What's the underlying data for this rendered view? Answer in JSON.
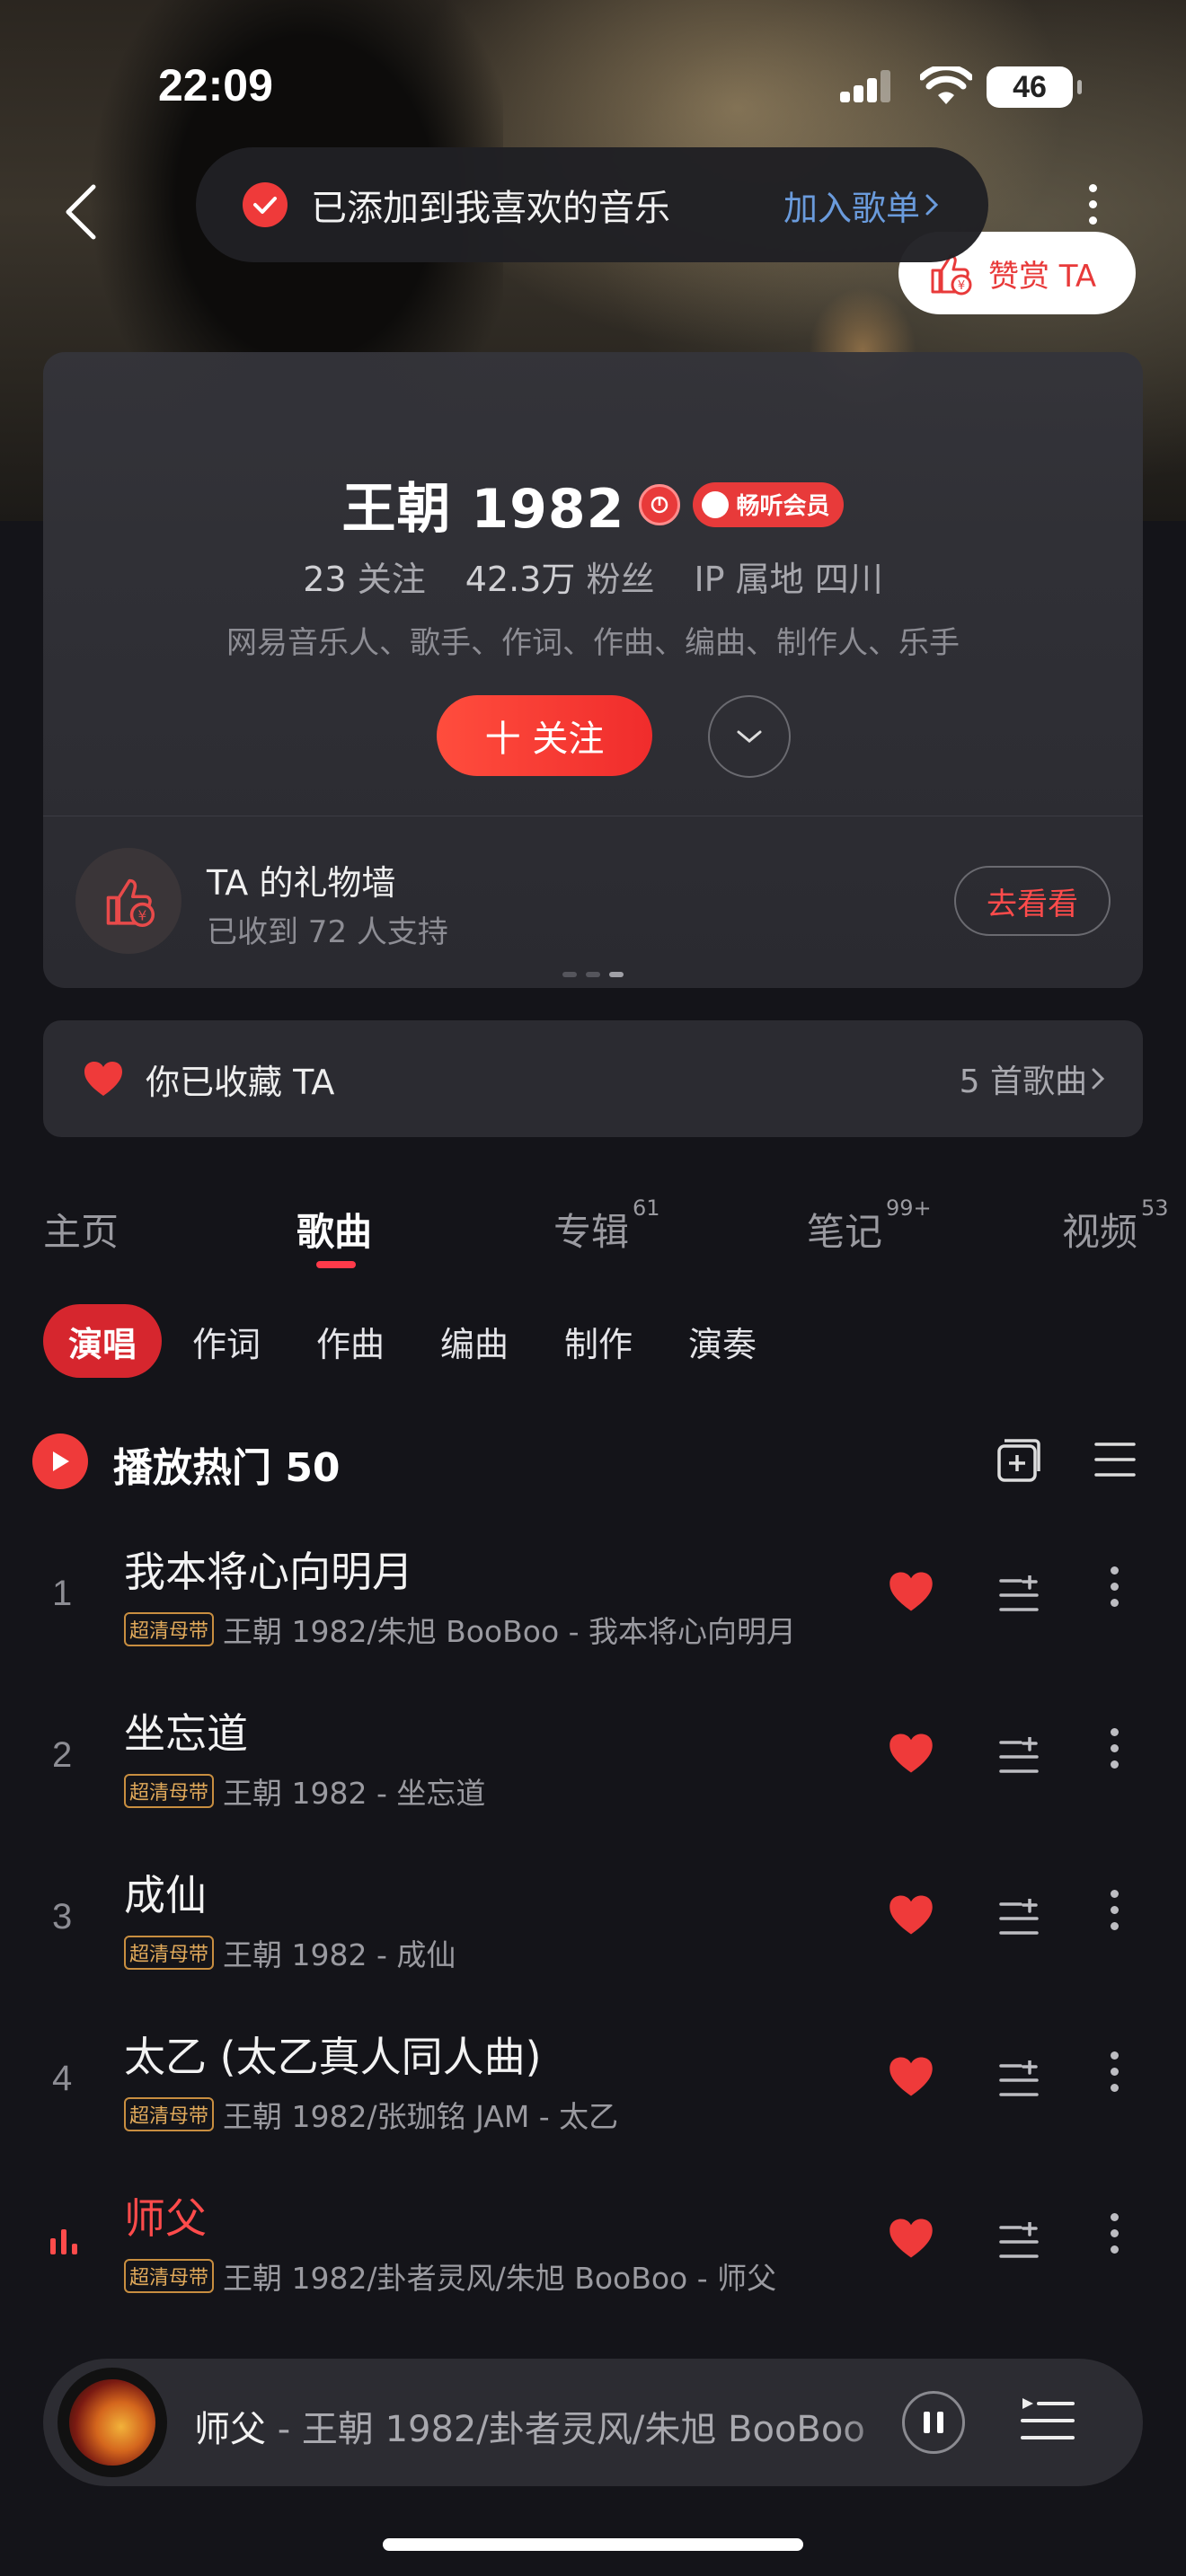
{
  "status": {
    "time": "22:09",
    "battery": "46"
  },
  "toast": {
    "message": "已添加到我喜欢的音乐",
    "action": "加入歌单"
  },
  "reward": {
    "label": "赞赏 TA"
  },
  "profile": {
    "name": "王朝 1982",
    "vip_label": "畅听会员",
    "follow_count": "23",
    "follow_label": "关注",
    "fans_count": "42.3万",
    "fans_label": "粉丝",
    "ip_label": "IP 属地 四川",
    "roles": "网易音乐人、歌手、作词、作曲、编曲、制作人、乐手",
    "follow_button": "十 关注"
  },
  "gift": {
    "title": "TA 的礼物墙",
    "subtitle": "已收到 72 人支持",
    "button": "去看看"
  },
  "collected": {
    "label": "你已收藏 TA",
    "count": "5 首歌曲"
  },
  "tabs": [
    {
      "label": "主页",
      "badge": ""
    },
    {
      "label": "歌曲",
      "badge": ""
    },
    {
      "label": "专辑",
      "badge": "61"
    },
    {
      "label": "笔记",
      "badge": "99+"
    },
    {
      "label": "视频",
      "badge": "53"
    }
  ],
  "filters": [
    "演唱",
    "作词",
    "作曲",
    "编曲",
    "制作",
    "演奏"
  ],
  "play_hot": "播放热门 50",
  "tag_label": "超清母带",
  "songs": [
    {
      "num": "1",
      "title": "我本将心向明月",
      "meta": "王朝 1982/朱旭 BooBoo - 我本将心向明月",
      "playing": false
    },
    {
      "num": "2",
      "title": "坐忘道",
      "meta": "王朝 1982 - 坐忘道",
      "playing": false
    },
    {
      "num": "3",
      "title": "成仙",
      "meta": "王朝 1982 - 成仙",
      "playing": false
    },
    {
      "num": "4",
      "title": "太乙 (太乙真人同人曲)",
      "meta": "王朝 1982/张珈铭 JAM - 太乙",
      "playing": false
    },
    {
      "num": "",
      "title": "师父",
      "meta": "王朝 1982/卦者灵风/朱旭 BooBoo - 师父",
      "playing": true
    }
  ],
  "player": {
    "title": "师父",
    "artist": " - 王朝 1982/卦者灵风/朱旭 BooBoo"
  },
  "colors": {
    "accent": "#ef3a3a",
    "background": "#141419",
    "link": "#6a9bdc"
  }
}
